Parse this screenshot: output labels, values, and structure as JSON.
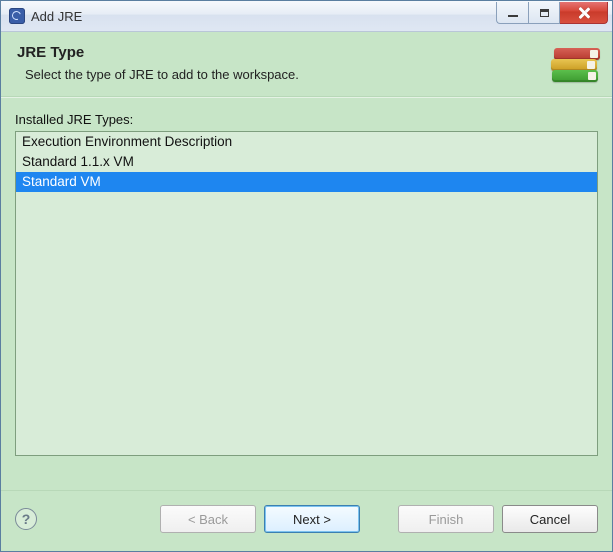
{
  "window": {
    "title": "Add JRE"
  },
  "header": {
    "title": "JRE Type",
    "subtitle": "Select the type of JRE to add to the workspace."
  },
  "list": {
    "label": "Installed JRE Types:",
    "items": [
      {
        "label": "Execution Environment Description",
        "selected": false
      },
      {
        "label": "Standard 1.1.x VM",
        "selected": false
      },
      {
        "label": "Standard VM",
        "selected": true
      }
    ]
  },
  "buttons": {
    "back": {
      "label": "< Back",
      "enabled": false
    },
    "next": {
      "label": "Next >",
      "enabled": true,
      "default": true
    },
    "finish": {
      "label": "Finish",
      "enabled": false
    },
    "cancel": {
      "label": "Cancel",
      "enabled": true
    }
  }
}
